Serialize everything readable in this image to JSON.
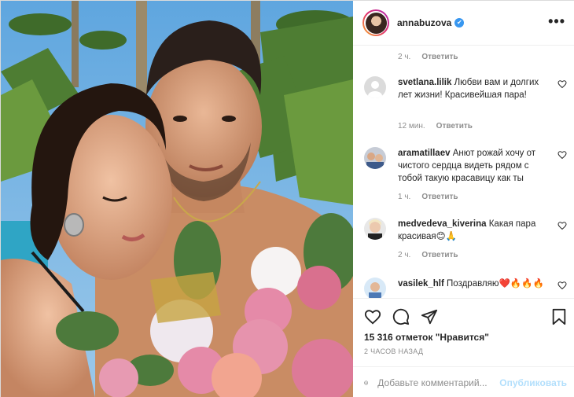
{
  "post": {
    "username": "annabuzova",
    "verified_mark": "✔",
    "more_glyph": "•••",
    "top_meta": {
      "time": "2 ч.",
      "reply": "Ответить"
    },
    "comments": [
      {
        "username": "svetlana.lilik",
        "text": "Любви вам и долгих лет жизни! Красивейшая пара!",
        "time": "12 мин.",
        "reply": "Ответить"
      },
      {
        "username": "aramatillaev",
        "text": "Анют рожай хочу от чистого сердца видеть рядом с тобой такую красавицу как ты",
        "time": "1 ч.",
        "reply": "Ответить"
      },
      {
        "username": "medvedeva_kiverina",
        "text": "Какая пара красивая😊🙏",
        "time": "2 ч.",
        "reply": "Ответить"
      },
      {
        "username": "vasilek_hlf",
        "text": "Поздравляю❤️🔥🔥🔥"
      }
    ],
    "likes": "15 316 отметок \"Нравится\"",
    "time_ago": "2 ЧАСОВ НАЗАД",
    "comment_placeholder": "Добавьте комментарий...",
    "publish_label": "Опубликовать",
    "icons": {
      "like": "heart-icon",
      "comment": "comment-icon",
      "share": "share-icon",
      "save": "bookmark-icon",
      "emoji": "emoji-icon"
    },
    "colors": {
      "accent": "#3897f0",
      "publish_disabled": "#b2dffc",
      "meta_gray": "#8e8e8e"
    }
  }
}
